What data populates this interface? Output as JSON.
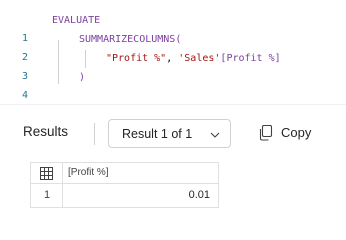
{
  "editor": {
    "lines": [
      {
        "number": "1",
        "tokens": [
          {
            "text": "EVALUATE",
            "kind": "kw"
          }
        ]
      },
      {
        "number": "2",
        "tokens": [
          {
            "text": "SUMMARIZECOLUMNS(",
            "kind": "fn"
          }
        ]
      },
      {
        "number": "3",
        "tokens": [
          {
            "text": "\"Profit %\"",
            "kind": "str"
          },
          {
            "text": ", ",
            "kind": "plain"
          },
          {
            "text": "'Sales'",
            "kind": "tbl"
          },
          {
            "text": "[Profit %]",
            "kind": "col"
          }
        ]
      },
      {
        "number": "4",
        "tokens": [
          {
            "text": ")",
            "kind": "fn"
          }
        ]
      }
    ]
  },
  "results": {
    "title": "Results",
    "selector_label": "Result 1 of 1",
    "copy_label": "Copy"
  },
  "grid": {
    "columns": [
      "[Profit %]"
    ],
    "rows": [
      {
        "row_number": "1",
        "values": [
          "0.01"
        ]
      }
    ]
  },
  "colors": {
    "keyword": "#7b3fa0",
    "string": "#a31515",
    "line_number": "#237893"
  },
  "icons": {
    "chevron": "chevron-down-icon",
    "copy": "copy-icon",
    "grid": "table-grid-icon"
  }
}
